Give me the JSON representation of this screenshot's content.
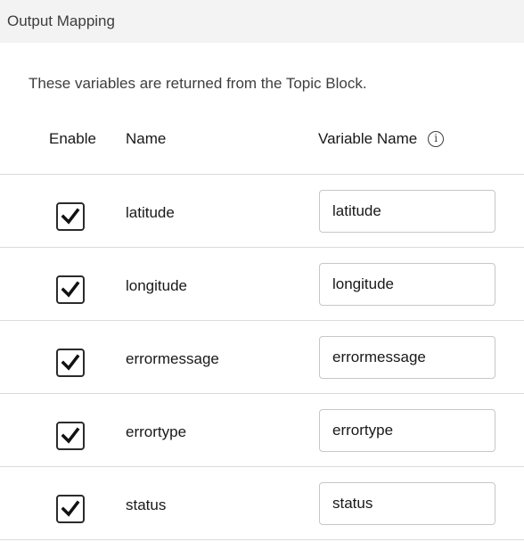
{
  "section": {
    "title": "Output Mapping"
  },
  "description": "These variables are returned from the Topic Block.",
  "columns": {
    "enable": "Enable",
    "name": "Name",
    "variable_name": "Variable Name",
    "info_icon": "info-icon"
  },
  "rows": [
    {
      "enabled": true,
      "name": "latitude",
      "variable_name": "latitude"
    },
    {
      "enabled": true,
      "name": "longitude",
      "variable_name": "longitude"
    },
    {
      "enabled": true,
      "name": "errormessage",
      "variable_name": "errormessage"
    },
    {
      "enabled": true,
      "name": "errortype",
      "variable_name": "errortype"
    },
    {
      "enabled": true,
      "name": "status",
      "variable_name": "status"
    }
  ]
}
